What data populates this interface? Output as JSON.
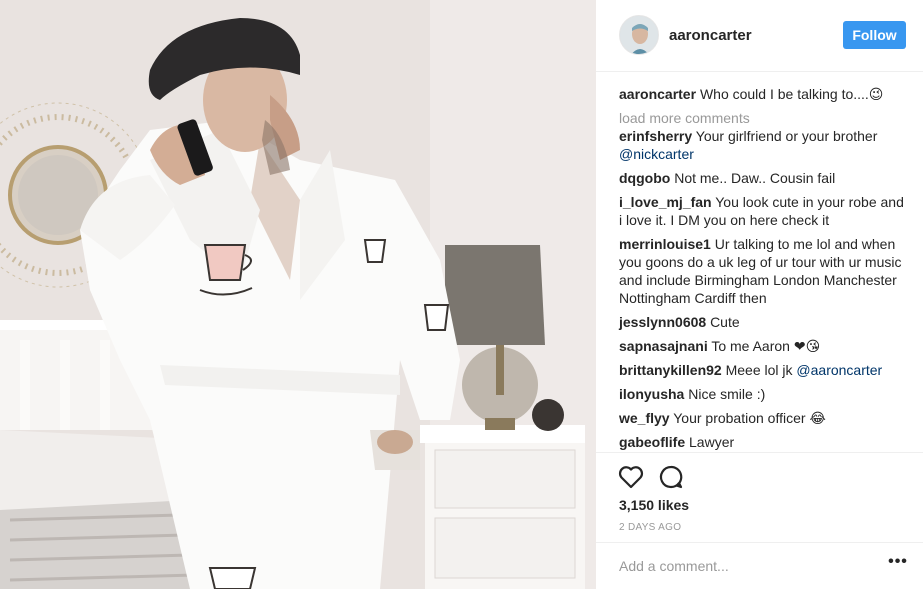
{
  "post": {
    "username": "aaroncarter",
    "follow_label": "Follow",
    "caption_user": "aaroncarter",
    "caption_text": "Who could I be talking to....😉",
    "load_more": "load more comments",
    "comments": [
      {
        "user": "erinfsherry",
        "text": "Your girlfriend or your brother ",
        "mention": "@nickcarter"
      },
      {
        "user": "dqgobo",
        "text": "Not me.. Daw.. Cousin fail"
      },
      {
        "user": "i_love_mj_fan",
        "text": "You look cute in your robe and i love it. I DM you on here check it"
      },
      {
        "user": "merrinlouise1",
        "text": "Ur talking to me lol and when you goons do a uk leg of ur tour with ur music and include Birmingham London Manchester Nottingham Cardiff then"
      },
      {
        "user": "jesslynn0608",
        "text": "Cute"
      },
      {
        "user": "sapnasajnani",
        "text": "To me Aaron ❤😘"
      },
      {
        "user": "brittanykillen92",
        "text": "Meee lol jk ",
        "mention": "@aaroncarter"
      },
      {
        "user": "ilonyusha",
        "text": "Nice smile :)"
      },
      {
        "user": "we_flyy",
        "text": "Your probation officer 😂"
      },
      {
        "user": "gabeoflife",
        "text": "Lawyer"
      }
    ],
    "likes": "3,150 likes",
    "time_ago": "2 DAYS AGO",
    "add_comment_placeholder": "Add a comment...",
    "more_label": "•••"
  },
  "icons": {
    "like": "heart-icon",
    "comment": "comment-bubble-icon",
    "more": "more-options-icon"
  },
  "colors": {
    "follow_button": "#3897f0",
    "mention": "#003569",
    "muted": "#999999"
  }
}
